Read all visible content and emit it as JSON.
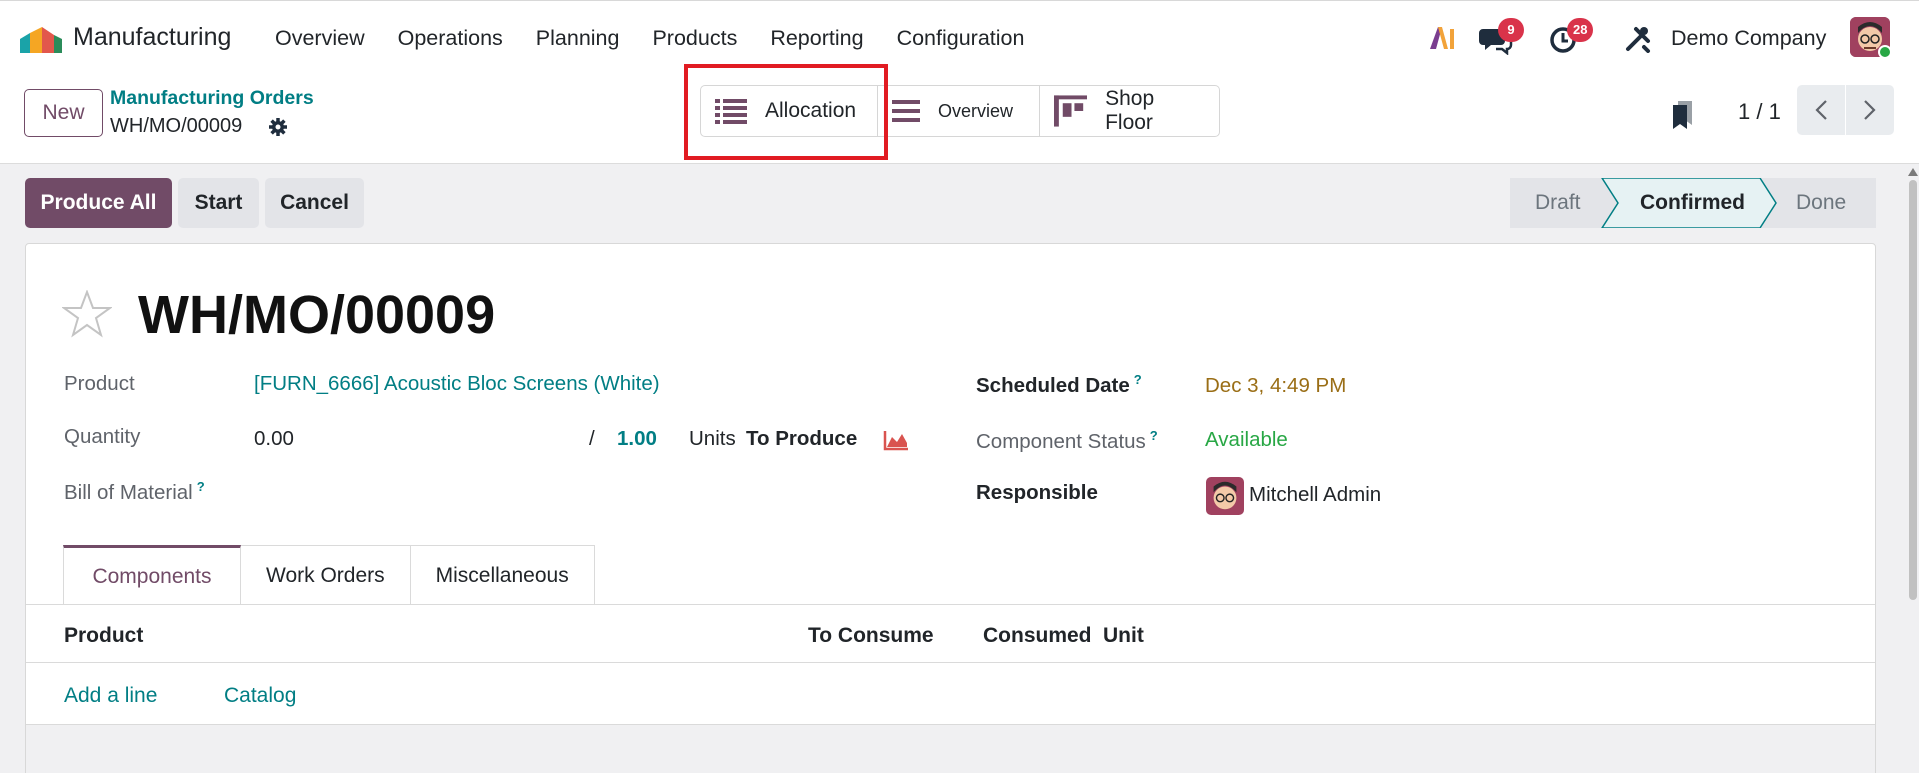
{
  "nav": {
    "app_name": "Manufacturing",
    "menu": [
      "Overview",
      "Operations",
      "Planning",
      "Products",
      "Reporting",
      "Configuration"
    ],
    "messages_count": "9",
    "activities_count": "28",
    "company": "Demo Company"
  },
  "control": {
    "new_label": "New",
    "breadcrumb_parent": "Manufacturing Orders",
    "breadcrumb_current": "WH/MO/00009",
    "views": [
      "Allocation",
      "Overview",
      "Shop Floor"
    ],
    "pager": "1 / 1"
  },
  "actions": {
    "produce_all": "Produce All",
    "start": "Start",
    "cancel": "Cancel"
  },
  "status": {
    "stages": [
      "Draft",
      "Confirmed",
      "Done"
    ],
    "current": "Confirmed"
  },
  "record": {
    "title": "WH/MO/00009",
    "product_label": "Product",
    "product_value": "[FURN_6666] Acoustic Bloc Screens (White)",
    "quantity_label": "Quantity",
    "quantity_value": "0.00",
    "quantity_sep": "/",
    "quantity_target": "1.00",
    "quantity_unit": "Units",
    "to_produce": "To Produce",
    "bom_label": "Bill of Material",
    "help_mark": "?",
    "scheduled_label": "Scheduled Date",
    "scheduled_value": "Dec 3, 4:49 PM",
    "component_status_label": "Component Status",
    "component_status_value": "Available",
    "responsible_label": "Responsible",
    "responsible_value": "Mitchell Admin"
  },
  "tabs": [
    "Components",
    "Work Orders",
    "Miscellaneous"
  ],
  "components_table": {
    "headers": [
      "Product",
      "To Consume",
      "Consumed",
      "Unit"
    ],
    "add_line": "Add a line",
    "catalog": "Catalog"
  },
  "colors": {
    "brand": "#714b67",
    "link": "#017e84",
    "warning_date": "#9a6e16",
    "available": "#28a745",
    "highlight": "#e11b22"
  }
}
